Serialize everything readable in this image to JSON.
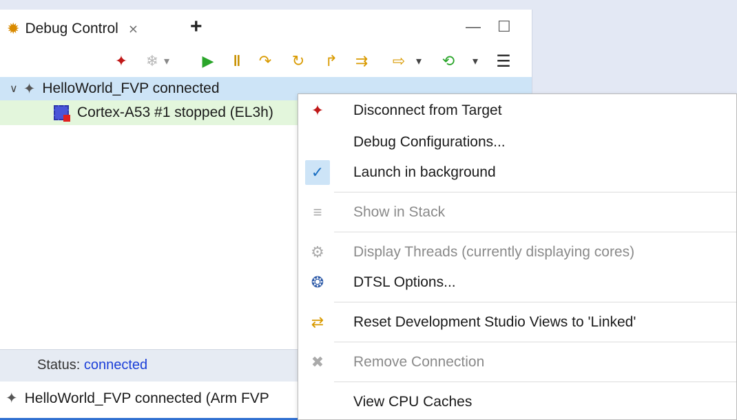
{
  "view": {
    "tab_label": "Debug Control",
    "tab_close": "⨯",
    "new_tab": "+",
    "minimize": "—",
    "maximize": "☐"
  },
  "toolbar": {
    "items": [
      {
        "name": "disconnect-icon",
        "glyph": "✦"
      },
      {
        "name": "connect-icon",
        "glyph": "❄"
      },
      {
        "name": "connect-dropdown-icon",
        "glyph": "▾"
      },
      {
        "name": "continue-icon",
        "glyph": "▶"
      },
      {
        "name": "interrupt-icon",
        "glyph": "‖"
      },
      {
        "name": "step-into-icon",
        "glyph": "↷"
      },
      {
        "name": "step-over-icon",
        "glyph": "↻"
      },
      {
        "name": "step-out-icon",
        "glyph": "↱"
      },
      {
        "name": "step-instruction-icon",
        "glyph": "⇉"
      },
      {
        "name": "run-to-icon",
        "glyph": "⇨"
      },
      {
        "name": "run-to-dropdown-icon",
        "glyph": "▾"
      },
      {
        "name": "sync-icon",
        "glyph": "⟲"
      },
      {
        "name": "sync-dropdown-icon",
        "glyph": "▾"
      },
      {
        "name": "menu-icon",
        "glyph": "☰"
      }
    ]
  },
  "tree": {
    "connection": "HelloWorld_FVP connected",
    "core": "Cortex-A53 #1 stopped (EL3h)"
  },
  "status": {
    "label": "Status:",
    "value": "connected"
  },
  "bottom": {
    "text": "HelloWorld_FVP connected (Arm FVP"
  },
  "context_menu": {
    "items": [
      {
        "label": "Disconnect from Target",
        "enabled": true,
        "icon": "disconnect-icon"
      },
      {
        "label": "Debug Configurations...",
        "enabled": true,
        "icon": ""
      },
      {
        "label": "Launch in background",
        "enabled": true,
        "icon": "checkmark-icon",
        "checked": true
      },
      {
        "label": "Show in Stack",
        "enabled": false,
        "icon": "stack-icon"
      },
      {
        "label": "Display Threads (currently displaying cores)",
        "enabled": false,
        "icon": "threads-icon"
      },
      {
        "label": "DTSL Options...",
        "enabled": true,
        "icon": "dtsl-icon"
      },
      {
        "label": "Reset Development Studio Views to 'Linked'",
        "enabled": true,
        "icon": "link-views-icon"
      },
      {
        "label": "Remove Connection",
        "enabled": false,
        "icon": "remove-icon"
      },
      {
        "label": "View CPU Caches",
        "enabled": true,
        "icon": ""
      }
    ]
  },
  "colors": {
    "selection": "#cde4f7",
    "stopped_row": "#e3f6dc",
    "status_link": "#1a3ed8",
    "continue": "#2aa52a",
    "step": "#d99a00"
  }
}
